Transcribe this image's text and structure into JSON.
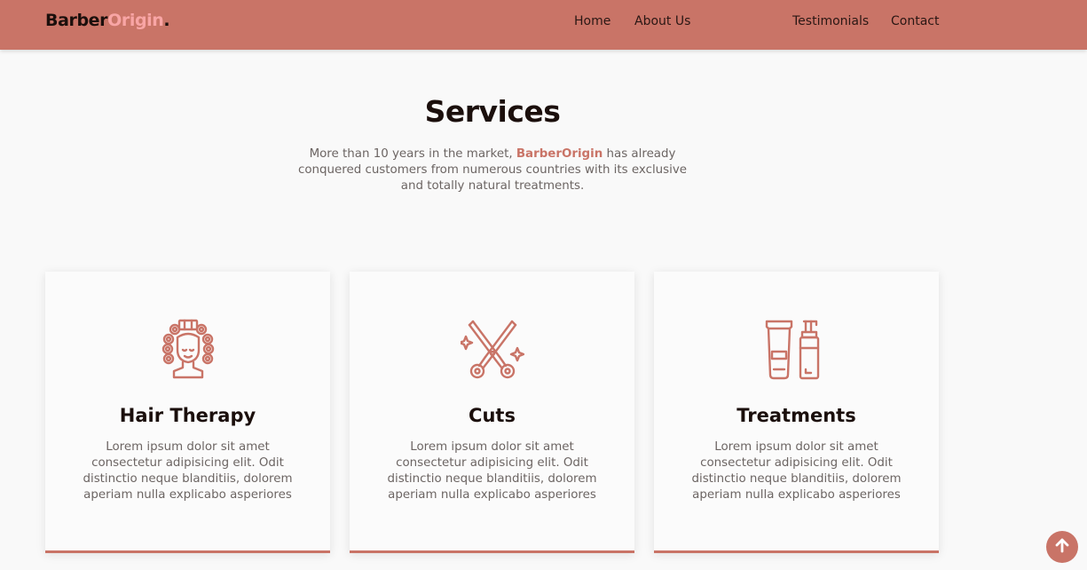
{
  "header": {
    "logo": {
      "part1": "Barber",
      "part2": "Origin",
      "dot": "."
    },
    "nav": [
      "Home",
      "About Us",
      "Testimonials",
      "Contact"
    ]
  },
  "services": {
    "title": "Services",
    "desc_before": "More than 10 years in the market, ",
    "desc_brand": "BarberOrigin",
    "desc_after": " has already conquered customers from numerous countries with its exclusive and totally natural treatments."
  },
  "cards": [
    {
      "icon": "hair-therapy-icon",
      "title": "Hair Therapy",
      "text": "Lorem ipsum dolor sit amet consectetur adipisicing elit. Odit distinctio neque blanditiis, dolorem aperiam nulla explicabo asperiores"
    },
    {
      "icon": "scissors-icon",
      "title": "Cuts",
      "text": "Lorem ipsum dolor sit amet consectetur adipisicing elit. Odit distinctio neque blanditiis, dolorem aperiam nulla explicabo asperiores"
    },
    {
      "icon": "treatment-bottles-icon",
      "title": "Treatments",
      "text": "Lorem ipsum dolor sit amet consectetur adipisicing elit. Odit distinctio neque blanditiis, dolorem aperiam nulla explicabo asperiores"
    }
  ],
  "scroll_top": {
    "icon": "arrow-up-icon"
  },
  "colors": {
    "accent": "#c97467",
    "logo_highlight": "#f8a5a5",
    "heading": "#1b0f0c",
    "body_text": "#6c6563",
    "background": "#f9f9f9"
  }
}
